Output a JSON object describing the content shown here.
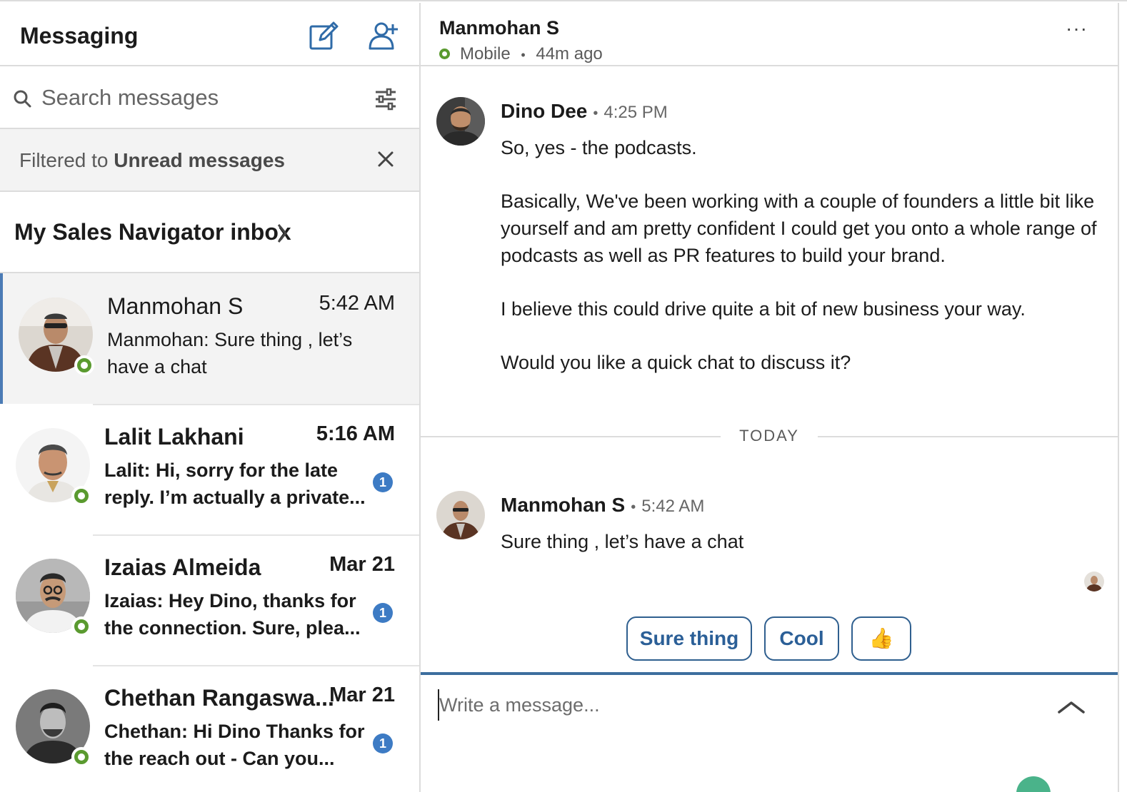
{
  "sidebar": {
    "title": "Messaging",
    "search_placeholder": "Search messages",
    "filter_prefix": "Filtered to ",
    "filter_value": "Unread messages",
    "inbox_title": "My Sales Navigator inbox",
    "conversations": [
      {
        "name": "Manmohan S",
        "time": "5:42 AM",
        "preview": "Manmohan: Sure thing , let’s have a chat",
        "unread_count": "",
        "online": true
      },
      {
        "name": "Lalit Lakhani",
        "time": "5:16 AM",
        "preview": "Lalit: Hi, sorry for the late reply. I’m actually a private...",
        "unread_count": "1",
        "online": true
      },
      {
        "name": "Izaias Almeida",
        "time": "Mar 21",
        "preview": "Izaias: Hey Dino, thanks for the connection. Sure, plea...",
        "unread_count": "1",
        "online": true
      },
      {
        "name": "Chethan Rangaswa...",
        "time": "Mar 21",
        "preview": "Chethan: Hi Dino  Thanks for the reach out - Can you...",
        "unread_count": "1",
        "online": true
      }
    ]
  },
  "thread": {
    "contact_name": "Manmohan S",
    "status_device": "Mobile",
    "status_separator": "•",
    "status_last_seen": "44m ago",
    "more_label": "···",
    "messages": [
      {
        "sender": "Dino Dee",
        "time": "4:25 PM",
        "paragraphs": [
          "So, yes - the podcasts.",
          "Basically, We've been working with a couple of founders a little bit like yourself and am pretty confident I could get you onto a whole range of podcasts as well as PR features to build your brand.",
          "I believe this could drive quite a bit of new business your way.",
          "Would you like a quick chat to discuss it?"
        ]
      },
      {
        "sender": "Manmohan S",
        "time": "5:42 AM",
        "paragraphs": [
          "Sure thing , let’s have a chat"
        ]
      }
    ],
    "separator_dot": "•",
    "divider_label": "TODAY",
    "quick_replies": [
      "Sure thing",
      "Cool",
      "👍"
    ],
    "composer_placeholder": "Write a message..."
  },
  "colors": {
    "accent_blue": "#2b5f97",
    "online_green": "#5a9a2f",
    "badge_blue": "#3d7bc4",
    "active_border": "#4b7bb5"
  },
  "icons": [
    "compose-icon",
    "add-people-icon",
    "search-icon",
    "filter-sliders-icon",
    "close-icon",
    "chevron-right-icon",
    "more-icon",
    "chevron-up-icon"
  ]
}
